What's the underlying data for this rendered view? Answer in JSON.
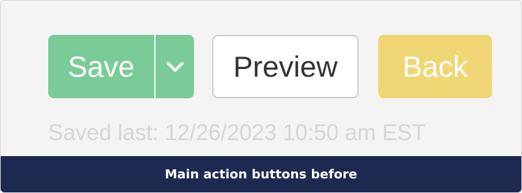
{
  "actions": {
    "save_label": "Save",
    "preview_label": "Preview",
    "back_label": "Back"
  },
  "status": {
    "saved_text": "Saved last: 12/26/2023 10:50 am EST"
  },
  "caption": {
    "text": "Main action buttons before"
  },
  "icons": {
    "save_toggle": "chevron-down-icon"
  },
  "colors": {
    "save": "#7bcb98",
    "back": "#f0d675",
    "caption_bar": "#1d2950"
  }
}
